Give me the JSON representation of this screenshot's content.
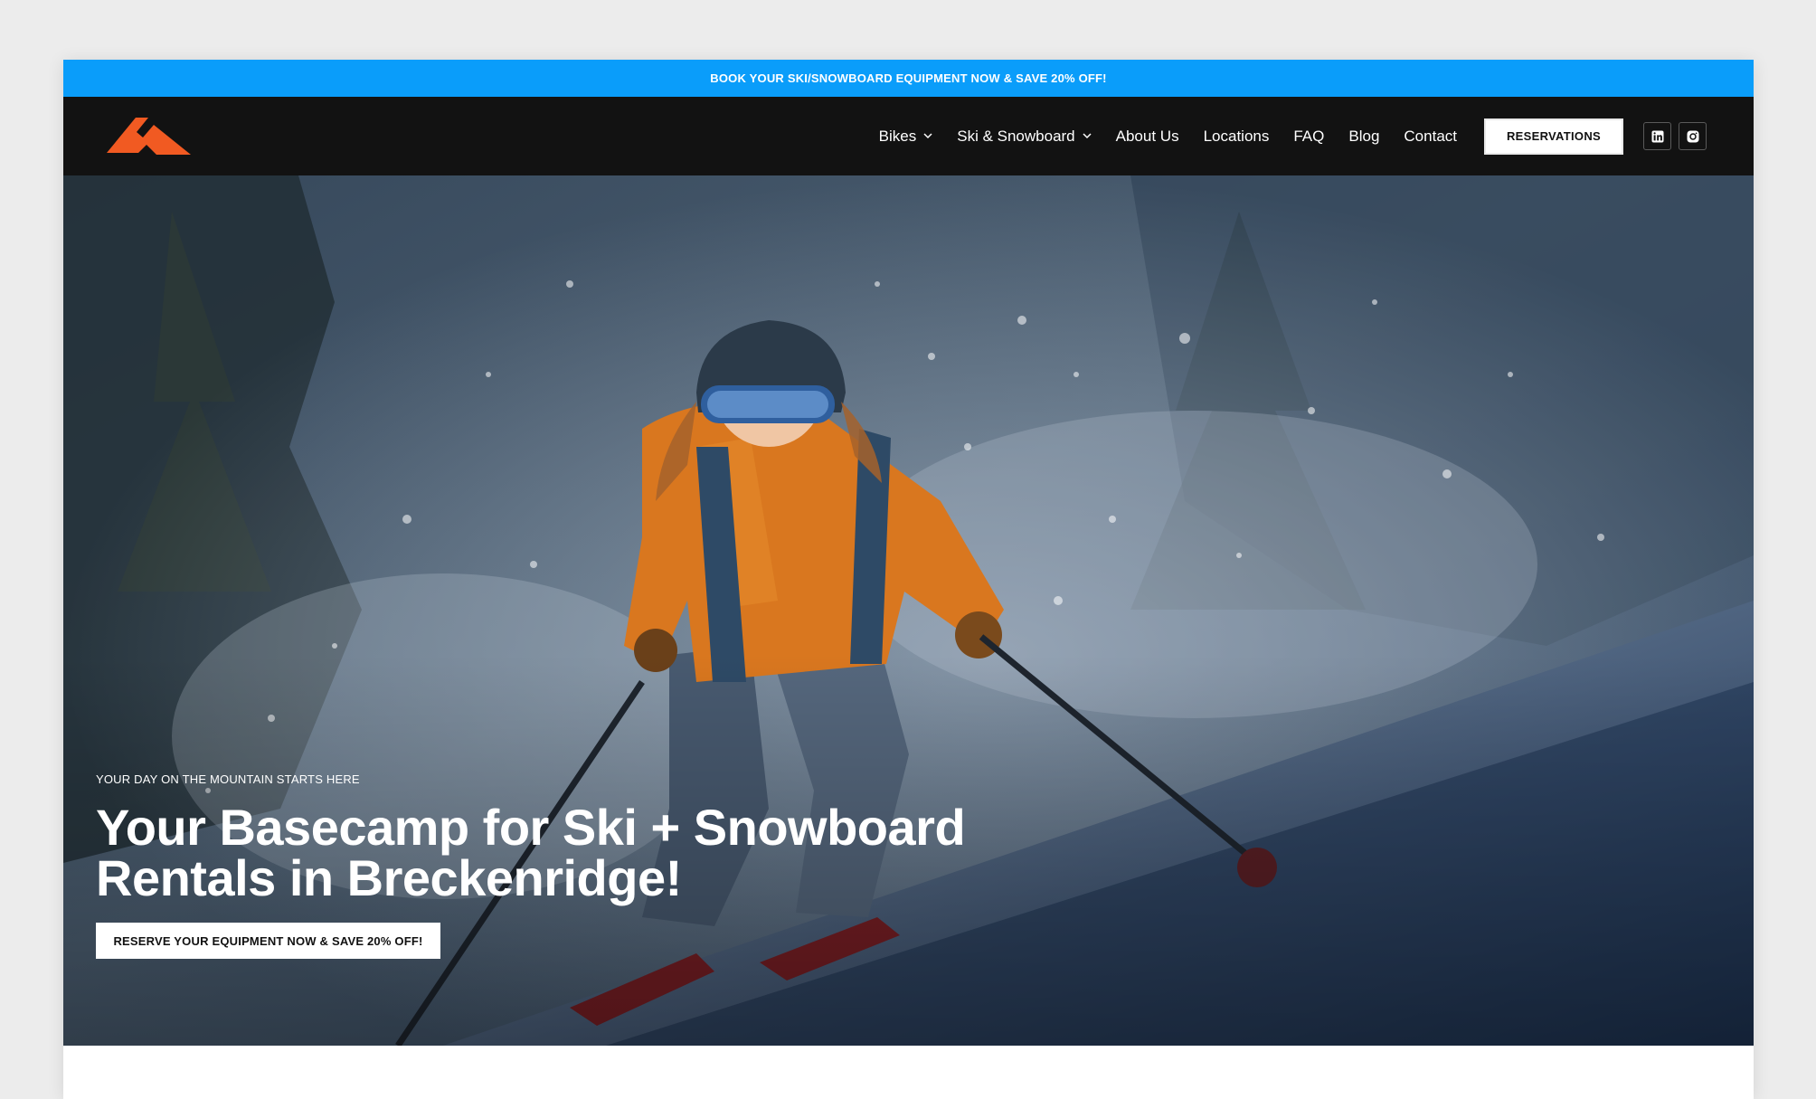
{
  "promo": {
    "text": "BOOK YOUR SKI/SNOWBOARD EQUIPMENT NOW & SAVE 20% OFF!"
  },
  "brand": {
    "logo_icon": "mountain-peak-icon",
    "accent_color": "#f15a22"
  },
  "nav": {
    "items": [
      {
        "label": "Bikes",
        "has_dropdown": true
      },
      {
        "label": "Ski & Snowboard",
        "has_dropdown": true
      },
      {
        "label": "About Us",
        "has_dropdown": false
      },
      {
        "label": "Locations",
        "has_dropdown": false
      },
      {
        "label": "FAQ",
        "has_dropdown": false
      },
      {
        "label": "Blog",
        "has_dropdown": false
      },
      {
        "label": "Contact",
        "has_dropdown": false
      }
    ],
    "reserve_label": "RESERVATIONS",
    "social": [
      {
        "icon": "linkedin-icon"
      },
      {
        "icon": "instagram-icon"
      }
    ]
  },
  "hero": {
    "eyebrow": "YOUR DAY ON THE MOUNTAIN STARTS HERE",
    "headline_line1": "Your Basecamp for Ski + Snowboard",
    "headline_line2": "Rentals in Breckenridge!",
    "cta_label": "RESERVE YOUR EQUIPMENT NOW & SAVE 20% OFF!",
    "image_subject": "skier-carving-powder-photo"
  },
  "colors": {
    "promo_bar": "#0a9dfa",
    "nav_bg": "#121212",
    "text_light": "#ffffff"
  }
}
